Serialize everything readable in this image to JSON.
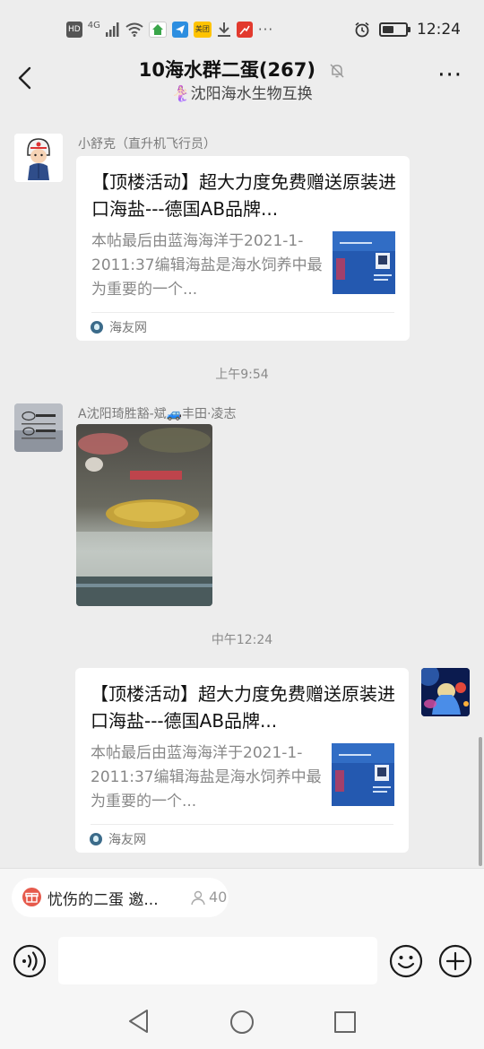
{
  "status_bar": {
    "network_label": "HD",
    "signal_label": "4G",
    "app_badge": "美团",
    "time": "12:24",
    "battery_level": 0.5
  },
  "header": {
    "title": "10海水群二蛋(267)",
    "subtitle": "🧜🏻‍♀️沈阳海水生物互换",
    "more_label": "···"
  },
  "messages": [
    {
      "sender": "小舒克（直升机飞行员）",
      "card": {
        "title": "【顶楼活动】超大力度免费赠送原装进口海盐---德国AB品牌...",
        "description": "本帖最后由蓝海海洋于2021-1-2011:37编辑海盐是海水饲养中最为重要的一个...",
        "source": "海友网"
      }
    },
    {
      "timestamp": "上午9:54",
      "sender": "A沈阳琦胜豁-斌🚙丰田·凌志"
    },
    {
      "timestamp": "中午12:24",
      "card": {
        "title": "【顶楼活动】超大力度免费赠送原装进口海盐---德国AB品牌...",
        "description": "本帖最后由蓝海海洋于2021-1-2011:37编辑海盐是海水饲养中最为重要的一个...",
        "source": "海友网"
      }
    }
  ],
  "pinned": {
    "text": "忧伤的二蛋 邀...",
    "count": "40"
  },
  "input": {
    "placeholder": ""
  },
  "colors": {
    "background": "#ededed",
    "card": "#ffffff",
    "pin_icon": "#e65a4c"
  }
}
